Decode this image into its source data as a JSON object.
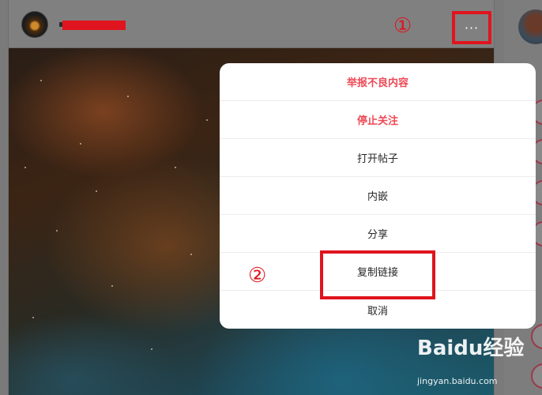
{
  "steps": {
    "first": "①",
    "second": "②"
  },
  "post": {
    "more_label": "···"
  },
  "menu": {
    "items": [
      {
        "label": "举报不良内容",
        "style": "danger"
      },
      {
        "label": "停止关注",
        "style": "danger"
      },
      {
        "label": "打开帖子",
        "style": "normal"
      },
      {
        "label": "内嵌",
        "style": "normal"
      },
      {
        "label": "分享",
        "style": "normal"
      },
      {
        "label": "复制链接",
        "style": "normal"
      },
      {
        "label": "取消",
        "style": "normal"
      }
    ]
  },
  "watermark": {
    "logo": "Baidu经验",
    "url": "jingyan.baidu.com"
  },
  "colors": {
    "annotation_red": "#e0141e",
    "danger_text": "#ed4956"
  }
}
